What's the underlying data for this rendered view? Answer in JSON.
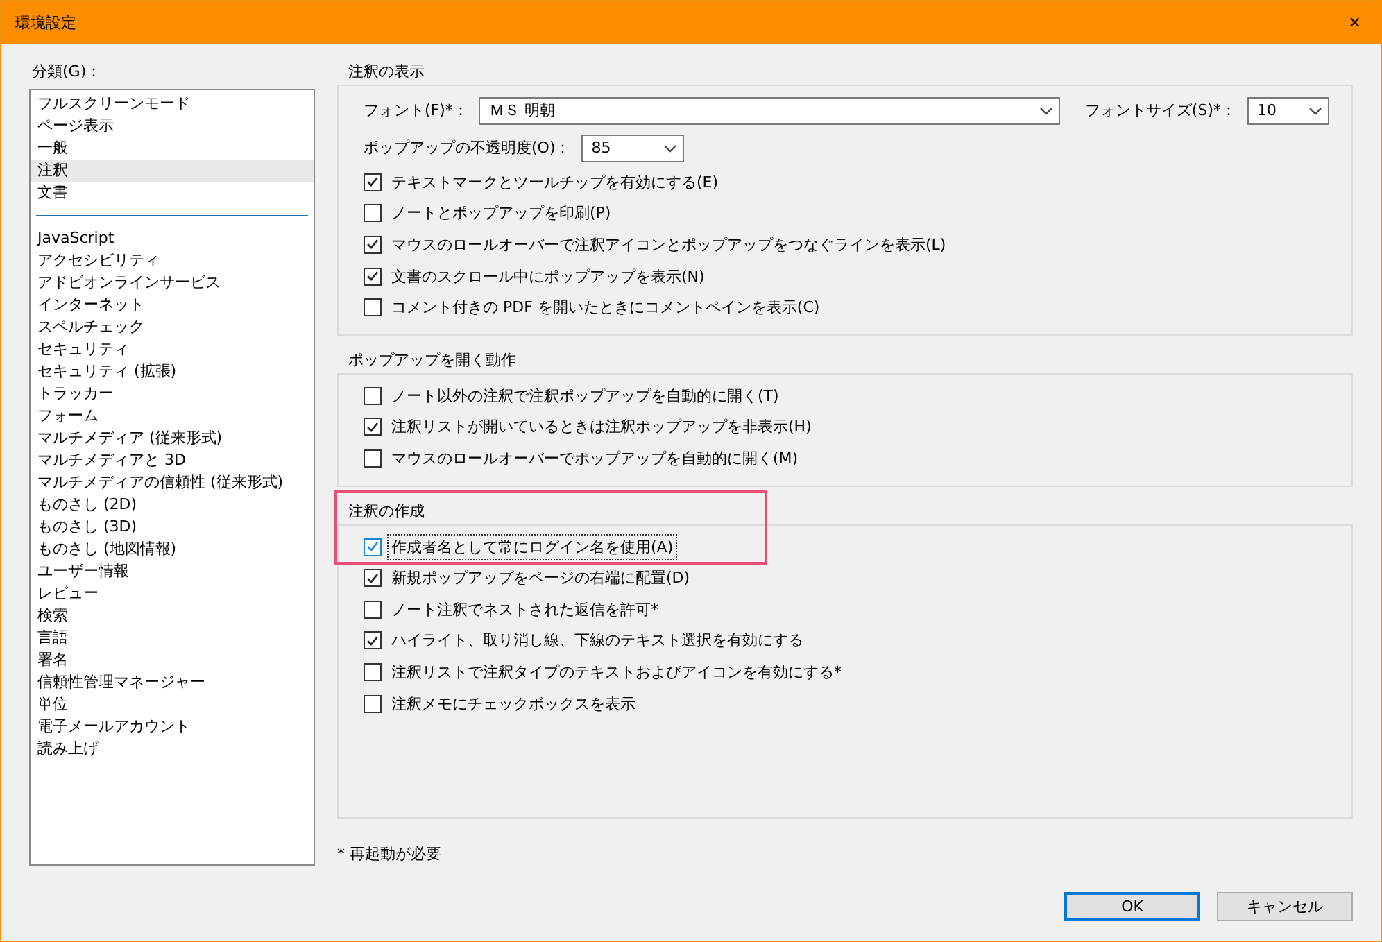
{
  "window": {
    "title": "環境設定",
    "close": "✕"
  },
  "categories": {
    "label": "分類(G)：",
    "groups": [
      {
        "items": [
          {
            "label": "フルスクリーンモード",
            "selected": false
          },
          {
            "label": "ページ表示",
            "selected": false
          },
          {
            "label": "一般",
            "selected": false
          },
          {
            "label": "注釈",
            "selected": true
          },
          {
            "label": "文書",
            "selected": false
          }
        ]
      },
      {
        "items": [
          {
            "label": "JavaScript",
            "selected": false
          },
          {
            "label": "アクセシビリティ",
            "selected": false
          },
          {
            "label": "アドビオンラインサービス",
            "selected": false
          },
          {
            "label": "インターネット",
            "selected": false
          },
          {
            "label": "スペルチェック",
            "selected": false
          },
          {
            "label": "セキュリティ",
            "selected": false
          },
          {
            "label": "セキュリティ (拡張)",
            "selected": false
          },
          {
            "label": "トラッカー",
            "selected": false
          },
          {
            "label": "フォーム",
            "selected": false
          },
          {
            "label": "マルチメディア (従来形式)",
            "selected": false
          },
          {
            "label": "マルチメディアと 3D",
            "selected": false
          },
          {
            "label": "マルチメディアの信頼性 (従来形式)",
            "selected": false
          },
          {
            "label": "ものさし (2D)",
            "selected": false
          },
          {
            "label": "ものさし (3D)",
            "selected": false
          },
          {
            "label": "ものさし (地図情報)",
            "selected": false
          },
          {
            "label": "ユーザー情報",
            "selected": false
          },
          {
            "label": "レビュー",
            "selected": false
          },
          {
            "label": "検索",
            "selected": false
          },
          {
            "label": "言語",
            "selected": false
          },
          {
            "label": "署名",
            "selected": false
          },
          {
            "label": "信頼性管理マネージャー",
            "selected": false
          },
          {
            "label": "単位",
            "selected": false
          },
          {
            "label": "電子メールアカウント",
            "selected": false
          },
          {
            "label": "読み上げ",
            "selected": false
          }
        ]
      }
    ]
  },
  "sections": [
    {
      "title": "注釈の表示",
      "highlighted": false,
      "fields": {
        "font_label": "フォント(F)*：",
        "font_value": "ＭＳ 明朝",
        "size_label": "フォントサイズ(S)*：",
        "size_value": "10",
        "opacity_label": "ポップアップの不透明度(O)：",
        "opacity_value": "85"
      },
      "options": [
        {
          "label": "テキストマークとツールチップを有効にする(E)",
          "checked": true,
          "focused": false
        },
        {
          "label": "ノートとポップアップを印刷(P)",
          "checked": false,
          "focused": false
        },
        {
          "label": "マウスのロールオーバーで注釈アイコンとポップアップをつなぐラインを表示(L)",
          "checked": true,
          "focused": false
        },
        {
          "label": "文書のスクロール中にポップアップを表示(N)",
          "checked": true,
          "focused": false
        },
        {
          "label": "コメント付きの PDF を開いたときにコメントペインを表示(C)",
          "checked": false,
          "focused": false
        }
      ]
    },
    {
      "title": "ポップアップを開く動作",
      "highlighted": false,
      "options": [
        {
          "label": "ノート以外の注釈で注釈ポップアップを自動的に開く(T)",
          "checked": false,
          "focused": false
        },
        {
          "label": "注釈リストが開いているときは注釈ポップアップを非表示(H)",
          "checked": true,
          "focused": false
        },
        {
          "label": "マウスのロールオーバーでポップアップを自動的に開く(M)",
          "checked": false,
          "focused": false
        }
      ]
    },
    {
      "title": "注釈の作成",
      "highlighted": true,
      "options": [
        {
          "label": "作成者名として常にログイン名を使用(A)",
          "checked": true,
          "focused": true
        },
        {
          "label": "新規ポップアップをページの右端に配置(D)",
          "checked": true,
          "focused": false
        },
        {
          "label": "ノート注釈でネストされた返信を許可*",
          "checked": false,
          "focused": false
        },
        {
          "label": "ハイライト、取り消し線、下線のテキスト選択を有効にする",
          "checked": true,
          "focused": false
        },
        {
          "label": "注釈リストで注釈タイプのテキストおよびアイコンを有効にする*",
          "checked": false,
          "focused": false
        },
        {
          "label": "注釈メモにチェックボックスを表示",
          "checked": false,
          "focused": false
        }
      ]
    }
  ],
  "footnote": "* 再起動が必要",
  "buttons": [
    {
      "label": "OK",
      "default": true
    },
    {
      "label": "キャンセル",
      "default": false
    }
  ]
}
